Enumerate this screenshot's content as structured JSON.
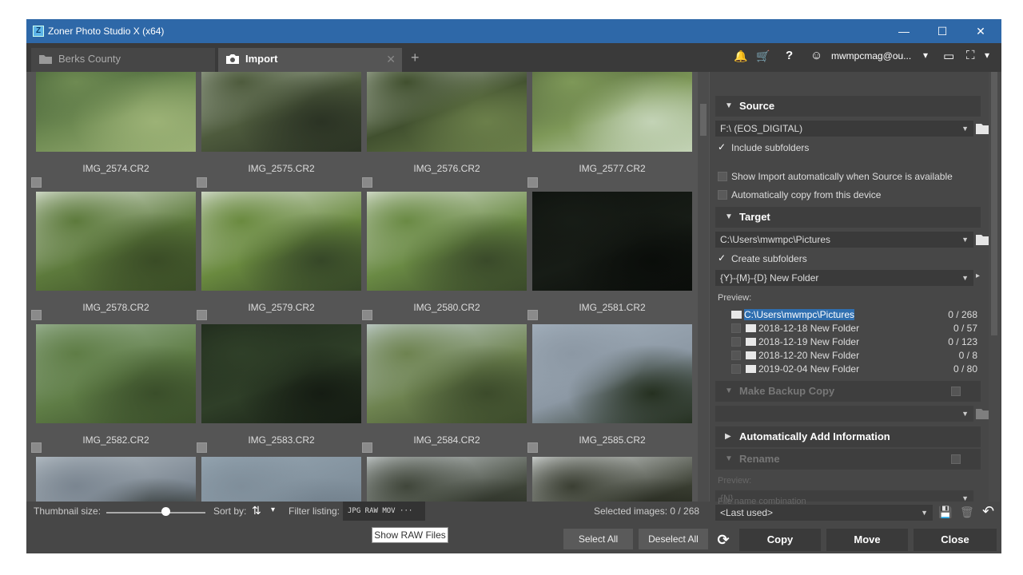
{
  "window": {
    "title": "Zoner Photo Studio X (x64)",
    "minimize": "—",
    "maximize": "☐",
    "close": "✕"
  },
  "tabs": [
    {
      "label": "Berks County",
      "close": "✕"
    },
    {
      "label": "Import",
      "close": "✕"
    }
  ],
  "new_tab": "+",
  "toolbar": {
    "bell": "🔔",
    "cart": "🛒",
    "help": "?",
    "user_icon": "☺",
    "user": "mwmpcmag@ou...",
    "user_arrow": "▾",
    "screen": "▭",
    "expand": "⛶",
    "expand_arrow": "▾"
  },
  "thumbnails": [
    {
      "name": "IMG_2574.CR2",
      "colors": [
        "#2f4a2a",
        "#6e8a52",
        "#9cb276"
      ]
    },
    {
      "name": "IMG_2575.CR2",
      "colors": [
        "#cfd7cc",
        "#4e5b3d",
        "#2b3324"
      ]
    },
    {
      "name": "IMG_2576.CR2",
      "colors": [
        "#e6ece4",
        "#41502f",
        "#6b7f4a"
      ]
    },
    {
      "name": "IMG_2577.CR2",
      "colors": [
        "#3c4c30",
        "#7e9858",
        "#c3d3b6"
      ]
    },
    {
      "name": "IMG_2578.CR2",
      "colors": [
        "#e3e9df",
        "#5d7a3c",
        "#3a4c26"
      ]
    },
    {
      "name": "IMG_2579.CR2",
      "colors": [
        "#dfe5dc",
        "#6a8a3f",
        "#364728"
      ]
    },
    {
      "name": "IMG_2580.CR2",
      "colors": [
        "#e0e6dc",
        "#6a8a44",
        "#3a4a2a"
      ]
    },
    {
      "name": "IMG_2581.CR2",
      "colors": [
        "#0e120e",
        "#171c16",
        "#0a0d0a"
      ]
    },
    {
      "name": "IMG_2582.CR2",
      "colors": [
        "#9fb69a",
        "#5f7d46",
        "#3a4e2a"
      ]
    },
    {
      "name": "IMG_2583.CR2",
      "colors": [
        "#1f2a1c",
        "#2f3f28",
        "#151c13"
      ]
    },
    {
      "name": "IMG_2584.CR2",
      "colors": [
        "#c7d3d6",
        "#6e8350",
        "#3c4b2b"
      ]
    },
    {
      "name": "IMG_2585.CR2",
      "colors": [
        "#a4b1bd",
        "#8c98a4",
        "#253020"
      ]
    },
    {
      "name": "",
      "colors": [
        "#b8c1c8",
        "#7a8590",
        "#1b1f18"
      ]
    },
    {
      "name": "",
      "colors": [
        "#97a7b3",
        "#7f8e9a",
        "#6b7985"
      ]
    },
    {
      "name": "",
      "colors": [
        "#d0d6d8",
        "#40463a",
        "#262a22"
      ]
    },
    {
      "name": "",
      "colors": [
        "#e0e4e4",
        "#3b3f33",
        "#1f2219"
      ]
    }
  ],
  "bottom": {
    "thumb_size_label": "Thumbnail size:",
    "thumb_size_value": 0.6,
    "sort_label": "Sort by:",
    "sort_icon": "⇅",
    "sort_arrow": "▾",
    "filter_label": "Filter listing:",
    "filter_options": "JPG RAW MOV ···",
    "tooltip": "Show RAW Files",
    "selected": "Selected images: 0 / 268",
    "select_all": "Select All",
    "deselect_all": "Deselect All"
  },
  "panel": {
    "source": {
      "title": "Source",
      "device": "F:\\ (EOS_DIGITAL)",
      "include_subfolders": "Include subfolders",
      "show_import_auto": "Show Import automatically when Source is available",
      "auto_copy": "Automatically copy from this device"
    },
    "target": {
      "title": "Target",
      "path": "C:\\Users\\mwmpc\\Pictures",
      "create_subfolders": "Create subfolders",
      "pattern": "{Y}-{M}-{D} New Folder",
      "preview_label": "Preview:",
      "tree": [
        {
          "name": "C:\\Users\\mwmpc\\Pictures",
          "count": "0 / 268"
        },
        {
          "name": "2018-12-18 New Folder",
          "count": "0 / 57"
        },
        {
          "name": "2018-12-19 New Folder",
          "count": "0 / 123"
        },
        {
          "name": "2018-12-20 New Folder",
          "count": "0 / 8"
        },
        {
          "name": "2019-02-04 New Folder",
          "count": "0 / 80"
        }
      ]
    },
    "backup": {
      "title": "Make Backup Copy"
    },
    "auto_info": {
      "title": "Automatically Add Information"
    },
    "rename": {
      "title": "Rename",
      "preview_label": "Preview:",
      "pattern": "{N}",
      "cut_text": "File name combination"
    },
    "preset": "<Last used>",
    "refresh": "⟳",
    "copy": "Copy",
    "move": "Move",
    "close": "Close",
    "check": "✓",
    "caret_down": "▼",
    "caret_right": "▶",
    "combo_arrow": "▼",
    "small_arrow": "▸",
    "save_icon": "💾",
    "trash_icon": "🗑",
    "undo_icon": "↶"
  }
}
